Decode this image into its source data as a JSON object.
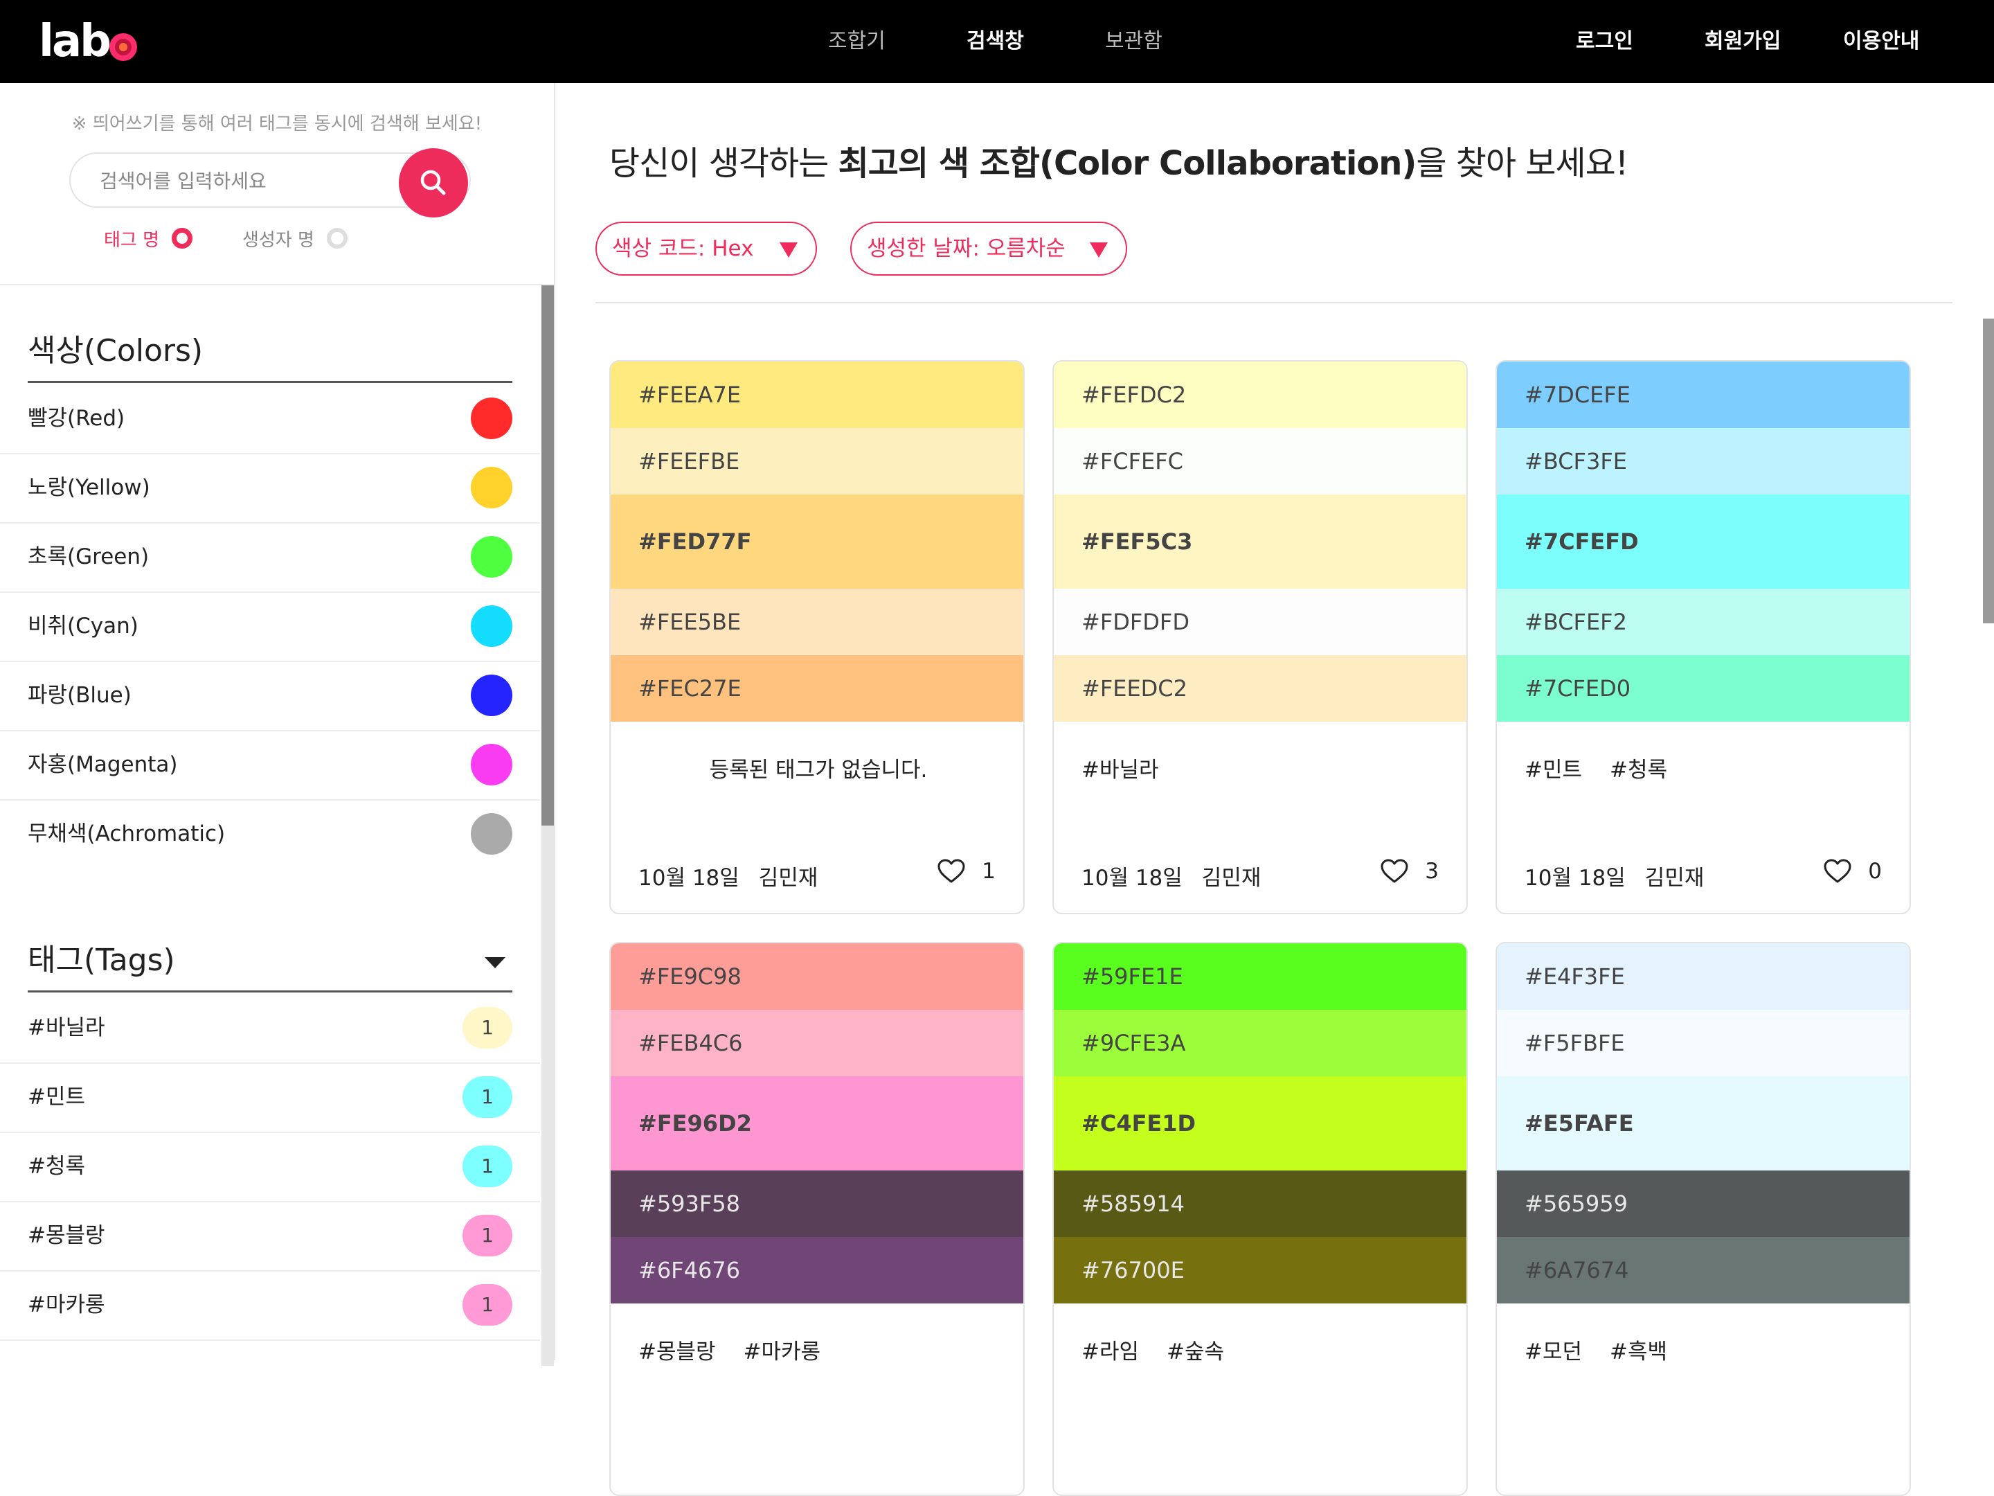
{
  "brand": {
    "logo_text": "lab"
  },
  "nav": {
    "center": [
      {
        "label": "조합기",
        "active": false
      },
      {
        "label": "검색창",
        "active": true
      },
      {
        "label": "보관함",
        "active": false
      }
    ],
    "right": [
      "로그인",
      "회원가입",
      "이용안내"
    ]
  },
  "sidebar": {
    "hint": "※ 띄어쓰기를 통해 여러 태그를 동시에 검색해 보세요!",
    "search_placeholder": "검색어를 입력하세요",
    "search_option_tag": "태그 명",
    "search_option_creator": "생성자 명",
    "colors_title": "색상(Colors)",
    "colors": [
      {
        "label": "빨강(Red)",
        "swatch": "#ff2a2a"
      },
      {
        "label": "노랑(Yellow)",
        "swatch": "#ffd12a"
      },
      {
        "label": "초록(Green)",
        "swatch": "#4dff3f"
      },
      {
        "label": "비취(Cyan)",
        "swatch": "#14dcff"
      },
      {
        "label": "파랑(Blue)",
        "swatch": "#2424ff"
      },
      {
        "label": "자홍(Magenta)",
        "swatch": "#f93cf2"
      },
      {
        "label": "무채색(Achromatic)",
        "swatch": "#aaaaaa"
      }
    ],
    "tags_title": "태그(Tags)",
    "tags": [
      {
        "label": "#바닐라",
        "count": "1",
        "badge": "#fff7c8"
      },
      {
        "label": "#민트",
        "count": "1",
        "badge": "#7effff"
      },
      {
        "label": "#청록",
        "count": "1",
        "badge": "#7effff"
      },
      {
        "label": "#몽블랑",
        "count": "1",
        "badge": "#ff9ad6"
      },
      {
        "label": "#마카롱",
        "count": "1",
        "badge": "#ff9ad6"
      }
    ]
  },
  "main": {
    "headline_pre": "당신이 생각하는 ",
    "headline_bold": "최고의 색 조합(Color Collaboration)",
    "headline_post": "을 찾아 보세요!",
    "filter_code": "색상 코드: Hex",
    "filter_date": "생성한 날짜: 오름차순",
    "accent": "#ee2c5c",
    "cards": [
      {
        "colors": [
          "#FEEA7E",
          "#FEEFBE",
          "#FED77F",
          "#FEE5BE",
          "#FEC27E"
        ],
        "tags": [],
        "empty_text": "등록된 태그가 없습니다.",
        "date": "10월 18일",
        "author": "김민재",
        "likes": "1"
      },
      {
        "colors": [
          "#FEFDC2",
          "#FCFEFC",
          "#FEF5C3",
          "#FDFDFD",
          "#FEEDC2"
        ],
        "tags": [
          "#바닐라"
        ],
        "date": "10월 18일",
        "author": "김민재",
        "likes": "3"
      },
      {
        "colors": [
          "#7DCEFE",
          "#BCF3FE",
          "#7CFEFD",
          "#BCFEF2",
          "#7CFED0"
        ],
        "tags": [
          "#민트",
          "#청록"
        ],
        "date": "10월 18일",
        "author": "김민재",
        "likes": "0"
      },
      {
        "colors": [
          "#FE9C98",
          "#FEB4C6",
          "#FE96D2",
          "#593F58",
          "#6F4676"
        ],
        "tags": [
          "#몽블랑",
          "#마카롱"
        ]
      },
      {
        "colors": [
          "#59FE1E",
          "#9CFE3A",
          "#C4FE1D",
          "#585914",
          "#76700E"
        ],
        "tags": [
          "#라임",
          "#숲속"
        ]
      },
      {
        "colors": [
          "#E4F3FE",
          "#F5FBFE",
          "#E5FAFE",
          "#565959",
          "#6A7674"
        ],
        "tags": [
          "#모던",
          "#흑백"
        ]
      }
    ]
  }
}
